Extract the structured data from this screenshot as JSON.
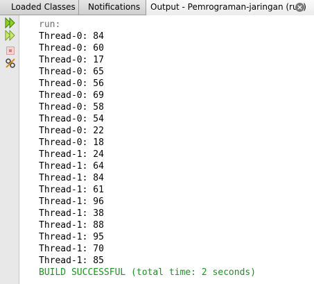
{
  "tabs": [
    {
      "label": "Loaded Classes"
    },
    {
      "label": "Notifications"
    },
    {
      "label": "Output - Pemrograman-jaringan (run)",
      "active": true
    }
  ],
  "toolbar": {
    "buttons": [
      {
        "name": "rerun-icon"
      },
      {
        "name": "rerun-with-different-parameters-icon"
      },
      {
        "name": "stop-icon"
      },
      {
        "name": "settings-icon"
      }
    ]
  },
  "output": {
    "header": "run:",
    "lines": [
      "Thread-0: 84",
      "Thread-0: 60",
      "Thread-0: 17",
      "Thread-0: 65",
      "Thread-0: 56",
      "Thread-0: 69",
      "Thread-0: 58",
      "Thread-0: 54",
      "Thread-0: 22",
      "Thread-0: 18",
      "Thread-1: 24",
      "Thread-1: 64",
      "Thread-1: 84",
      "Thread-1: 61",
      "Thread-1: 96",
      "Thread-1: 38",
      "Thread-1: 88",
      "Thread-1: 95",
      "Thread-1: 70",
      "Thread-1: 85"
    ],
    "footer": "BUILD SUCCESSFUL (total time: 2 seconds)"
  },
  "colors": {
    "success": "#18961b",
    "run_label": "#6f6f6f",
    "play_icon": "#8fd21e"
  }
}
